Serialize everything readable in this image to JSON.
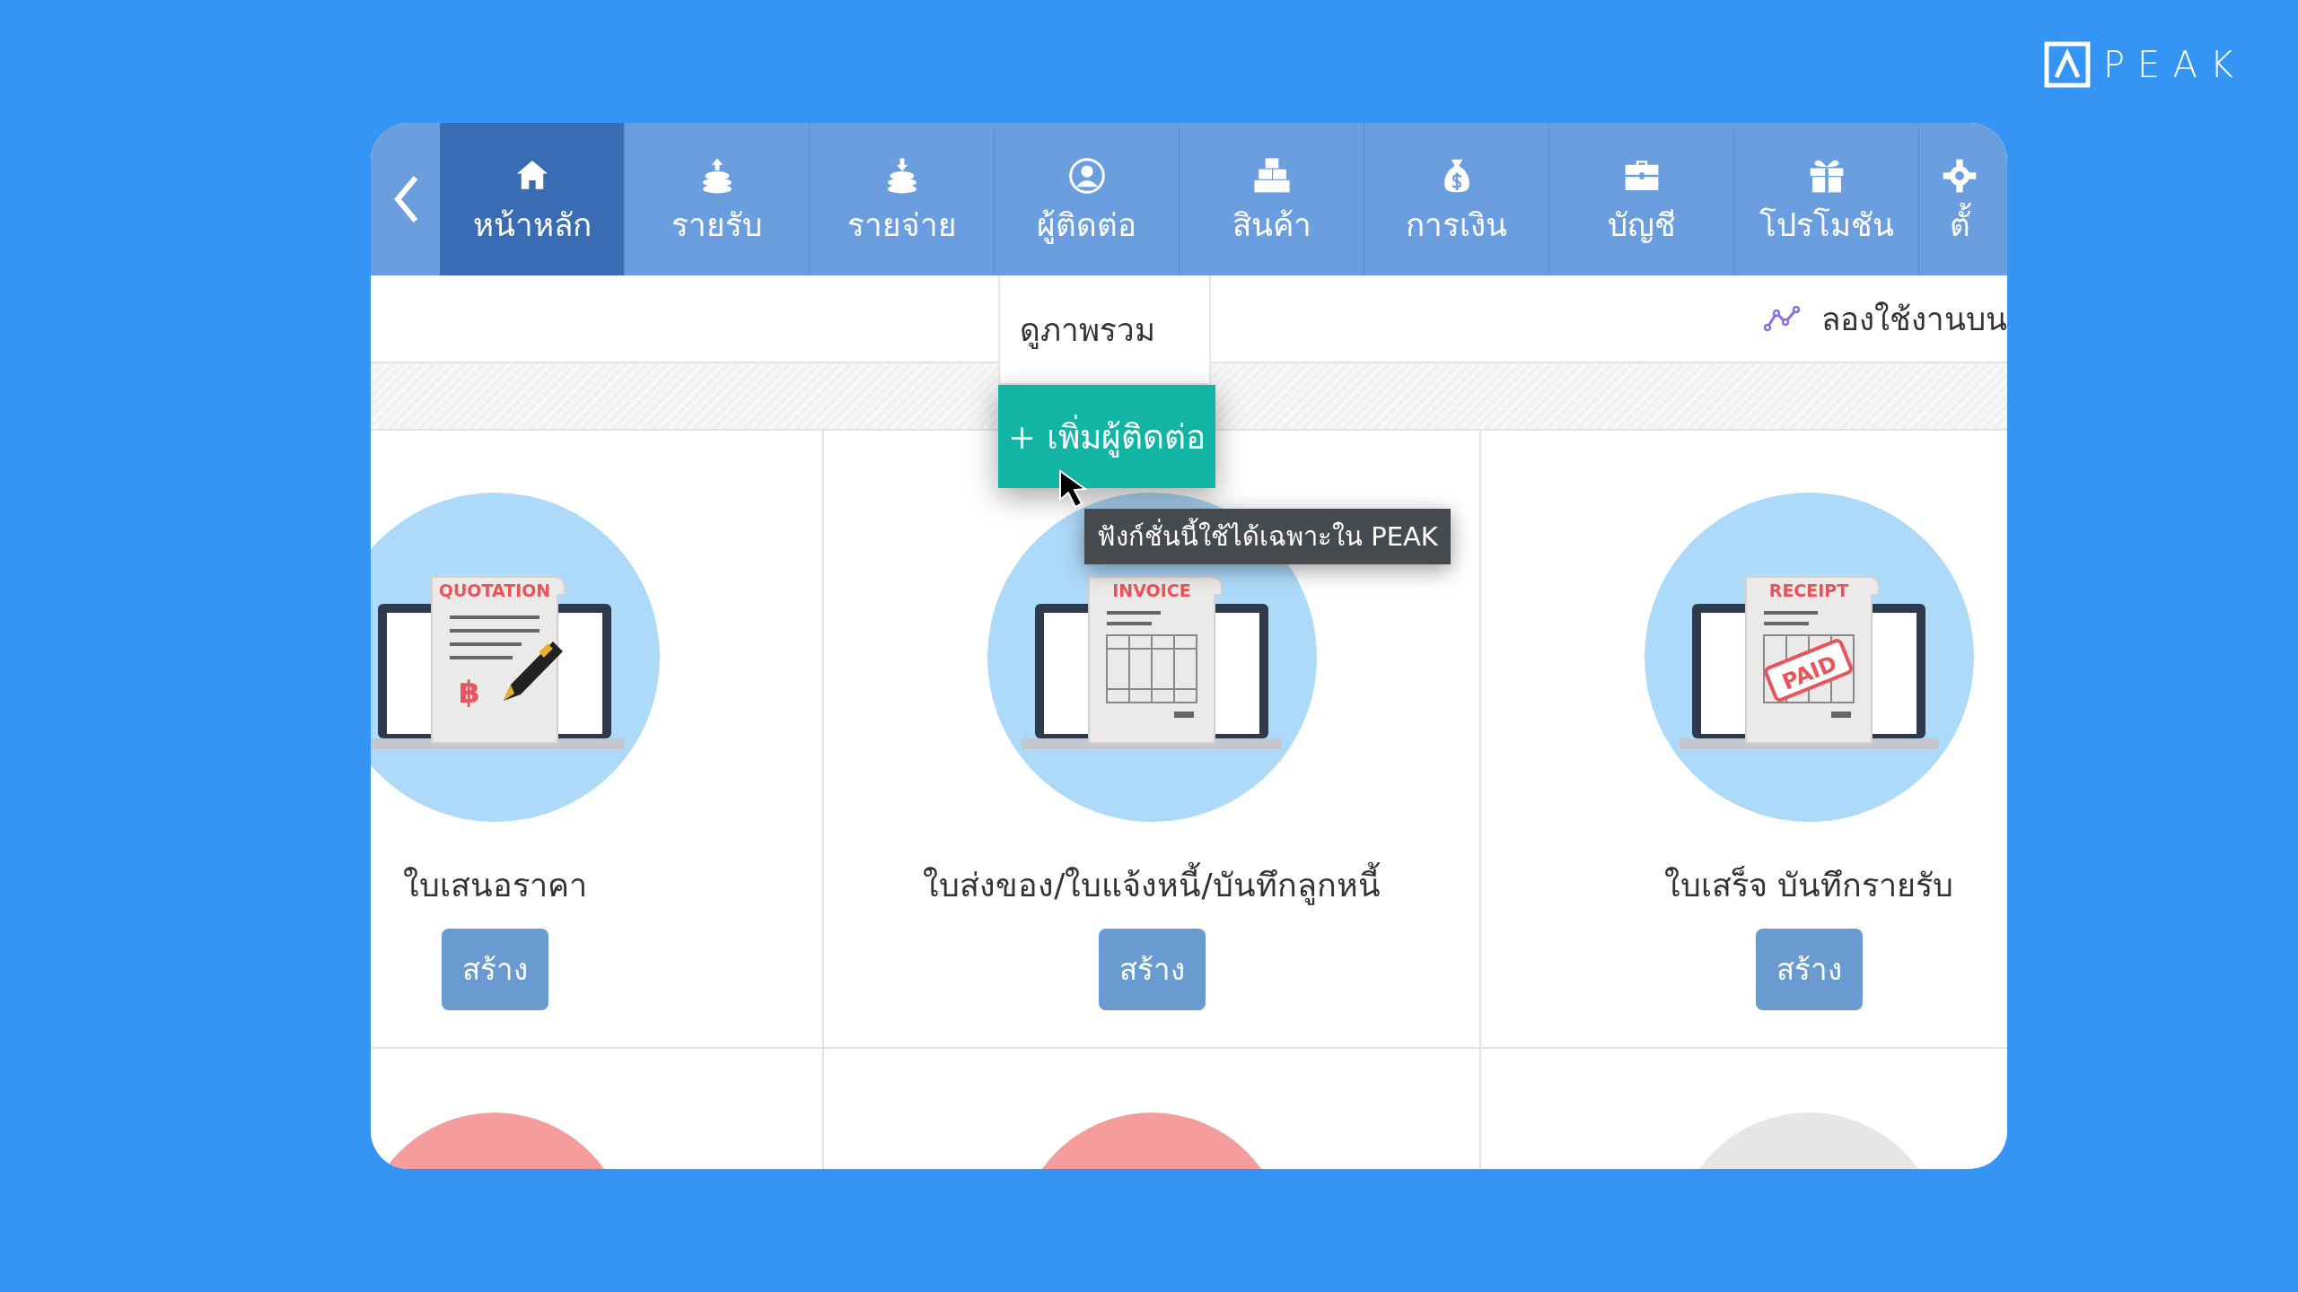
{
  "logo": {
    "text": "PEAK"
  },
  "nav": {
    "tabs": [
      {
        "label": "หน้าหลัก",
        "selected": true
      },
      {
        "label": "รายรับ",
        "selected": false
      },
      {
        "label": "รายจ่าย",
        "selected": false
      },
      {
        "label": "ผู้ติดต่อ",
        "selected": false
      },
      {
        "label": "สินค้า",
        "selected": false
      },
      {
        "label": "การเงิน",
        "selected": false
      },
      {
        "label": "บัญชี",
        "selected": false
      },
      {
        "label": "โปรโมชัน",
        "selected": false
      },
      {
        "label": "ตั้",
        "selected": false
      }
    ]
  },
  "dropdown": {
    "items": [
      {
        "label": "ดูภาพรวม",
        "kind": "link"
      },
      {
        "label": "+ เพิ่มผู้ติดต่อ",
        "kind": "action"
      }
    ]
  },
  "trial_link": "ลองใช้งานบน",
  "tooltip": "ฟังก์ชั่นนี้ใช้ได้เฉพาะใน PEAK",
  "cards": [
    {
      "kind": "quotation",
      "doc_label": "QUOTATION",
      "mark": "฿",
      "title": "ใบเสนอราคา",
      "button": "สร้าง"
    },
    {
      "kind": "invoice",
      "doc_label": "INVOICE",
      "title": "ใบส่งของ/ใบแจ้งหนี้/บันทึกลูกหนี้",
      "button": "สร้าง"
    },
    {
      "kind": "receipt",
      "doc_label": "RECEIPT",
      "mark": "PAID",
      "title": "ใบเสร็จ บันทึกรายรับ",
      "button": "สร้าง"
    }
  ],
  "next_row": [
    {
      "color": "#f59c9c"
    },
    {
      "color": "#f59c9c"
    },
    {
      "color": "#e6e6e6"
    }
  ]
}
